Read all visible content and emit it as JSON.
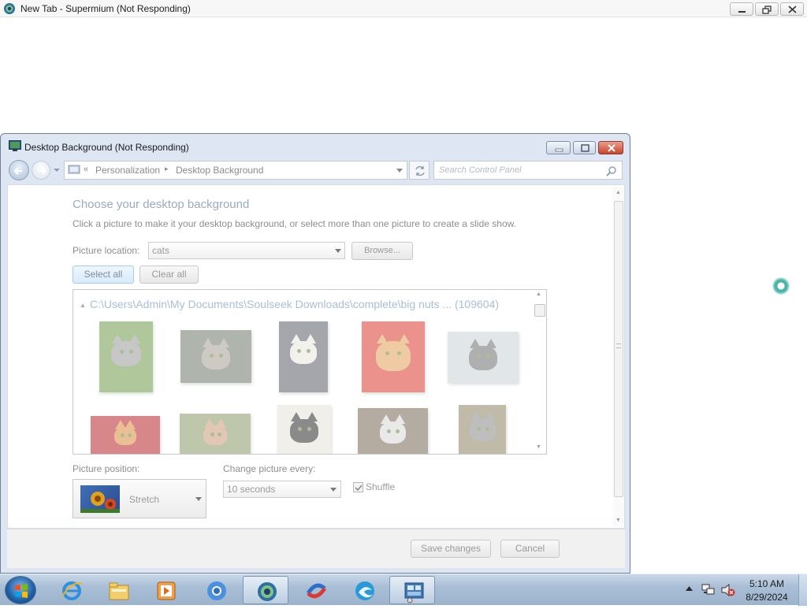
{
  "browser": {
    "title": "New Tab - Supermium (Not Responding)"
  },
  "dialog": {
    "title": "Desktop Background (Not Responding)",
    "breadcrumb": {
      "chevrons": "«",
      "items": [
        "Personalization",
        "Desktop Background"
      ]
    },
    "search_placeholder": "Search Control Panel",
    "heading": "Choose your desktop background",
    "description": "Click a picture to make it your desktop background, or select more than one picture to create a slide show.",
    "picture_location": {
      "label": "Picture location:",
      "value": "cats"
    },
    "browse_label": "Browse...",
    "select_all_label": "Select all",
    "clear_all_label": "Clear all",
    "group": {
      "path": "C:\\Users\\Admin\\My Documents\\Soulseek Downloads\\complete\\big nuts ... (109604)",
      "thumbnails": [
        {
          "name": "cat-1",
          "bg": "#6f9a4a",
          "fur": "#9a9a9a"
        },
        {
          "name": "cat-2",
          "bg": "#6f7a6a",
          "fur": "#a7a093"
        },
        {
          "name": "cat-3",
          "bg": "#5b5f68",
          "fur": "#eae6dd"
        },
        {
          "name": "cat-4",
          "bg": "#d93a2e",
          "fur": "#e2a15b"
        },
        {
          "name": "cat-5",
          "bg": "#c9d2d6",
          "fur": "#6f6f6f"
        },
        {
          "name": "cat-6",
          "bg": "#b8242a",
          "fur": "#d98b3b"
        },
        {
          "name": "cat-7",
          "bg": "#8a9a6a",
          "fur": "#c99b78"
        },
        {
          "name": "cat-8",
          "bg": "#e6e3da",
          "fur": "#2c2c2c"
        },
        {
          "name": "cat-9",
          "bg": "#7a6a55",
          "fur": "#d8d8d8"
        },
        {
          "name": "cat-10",
          "bg": "#8e8362",
          "fur": "#8a8a8a"
        }
      ]
    },
    "picture_position": {
      "label": "Picture position:",
      "value": "Stretch"
    },
    "change_picture": {
      "label": "Change picture every:",
      "value": "10 seconds"
    },
    "shuffle_label": "Shuffle",
    "shuffle_checked": true,
    "save_label": "Save changes",
    "cancel_label": "Cancel"
  },
  "taskbar": {
    "items": [
      {
        "name": "internet-explorer",
        "icon": "ie-icon"
      },
      {
        "name": "file-explorer",
        "icon": "folder-icon"
      },
      {
        "name": "media-player",
        "icon": "media-icon"
      },
      {
        "name": "chromium-browser",
        "icon": "chromium-icon"
      },
      {
        "name": "supermium",
        "icon": "supermium-icon",
        "active": true
      },
      {
        "name": "app-swirl",
        "icon": "swirl-icon"
      },
      {
        "name": "edge",
        "icon": "edge-icon"
      },
      {
        "name": "control-panel",
        "icon": "control-panel-icon",
        "active": true
      }
    ],
    "clock": {
      "time": "5:10 AM",
      "date": "8/29/2024"
    }
  }
}
